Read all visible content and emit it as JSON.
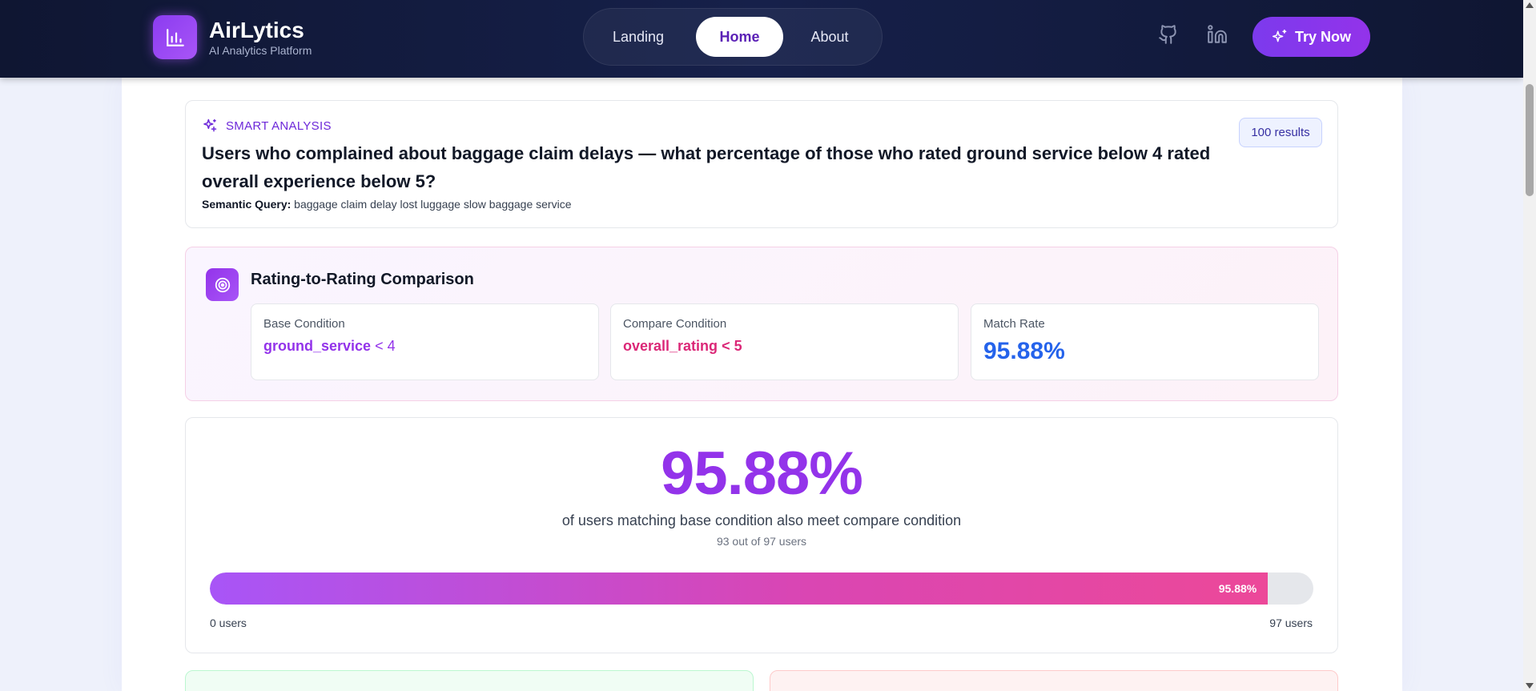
{
  "header": {
    "brand_name": "AirLytics",
    "brand_subtitle": "AI Analytics Platform",
    "nav": [
      {
        "label": "Landing"
      },
      {
        "label": "Home"
      },
      {
        "label": "About"
      }
    ],
    "active_nav": "Home",
    "cta_label": "Try Now",
    "icons": [
      "chart-logo-icon",
      "github-icon",
      "linkedin-icon",
      "sparkles-icon"
    ]
  },
  "query": {
    "section_label": "SMART ANALYSIS",
    "title": "Users who complained about baggage claim delays — what percentage of those who rated ground service below 4 rated overall experience below 5?",
    "semantic_label": "Semantic Query:",
    "semantic_value": "baggage claim delay lost luggage slow baggage service",
    "results_badge": "100 results"
  },
  "comparison": {
    "title": "Rating-to-Rating Comparison",
    "base": {
      "label": "Base Condition",
      "field": "ground_service",
      "op": "< 4"
    },
    "compare": {
      "label": "Compare Condition",
      "field": "overall_rating",
      "op": "< 5"
    },
    "match": {
      "label": "Match Rate",
      "value": "95.88%"
    }
  },
  "result": {
    "percentage": "95.88%",
    "fill_fraction": 0.9588,
    "description": "of users matching base condition also meet compare condition",
    "count_text": "93 out of 97 users",
    "bar_label": "95.88%",
    "axis_min": "0 users",
    "axis_max": "97 users"
  },
  "colors": {
    "accent": "#9333ea",
    "pink": "#db2777",
    "blue": "#2563eb",
    "nav_bg": "#0f1632"
  }
}
